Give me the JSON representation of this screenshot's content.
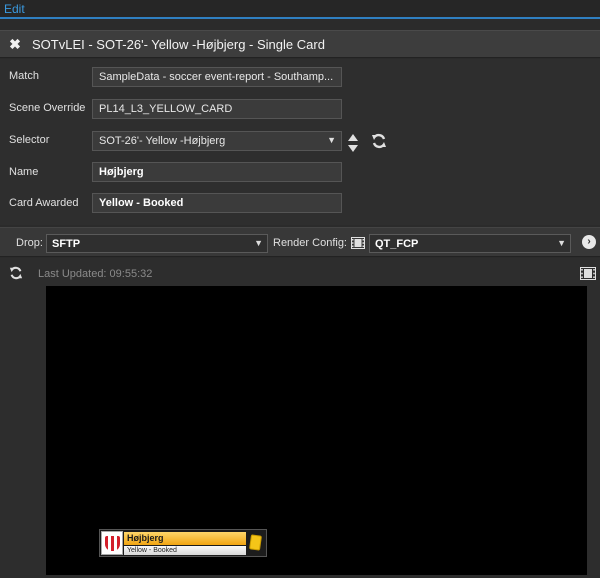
{
  "topbar": {
    "edit_label": "Edit"
  },
  "title": {
    "text": "SOTvLEI - SOT-26'- Yellow -Højbjerg - Single Card"
  },
  "form": {
    "match": {
      "label": "Match",
      "value": "SampleData - soccer event-report - Southamp..."
    },
    "scene_override": {
      "label": "Scene Override",
      "value": "PL14_L3_YELLOW_CARD"
    },
    "selector": {
      "label": "Selector",
      "value": "SOT-26'- Yellow -Højbjerg"
    },
    "name": {
      "label": "Name",
      "value": "Højbjerg"
    },
    "card_awarded": {
      "label": "Card Awarded",
      "value": "Yellow - Booked"
    }
  },
  "dropbar": {
    "drop_label": "Drop:",
    "drop_value": "SFTP",
    "render_label": "Render Config:",
    "render_value": "QT_FCP"
  },
  "preview": {
    "last_updated": "Last Updated: 09:55:32",
    "lower_third": {
      "name": "Højbjerg",
      "subtitle": "Yellow - Booked"
    }
  },
  "colors": {
    "accent": "#2f7fc1",
    "card_yellow": "#f5c518",
    "bar_gold": "#f2a512"
  }
}
